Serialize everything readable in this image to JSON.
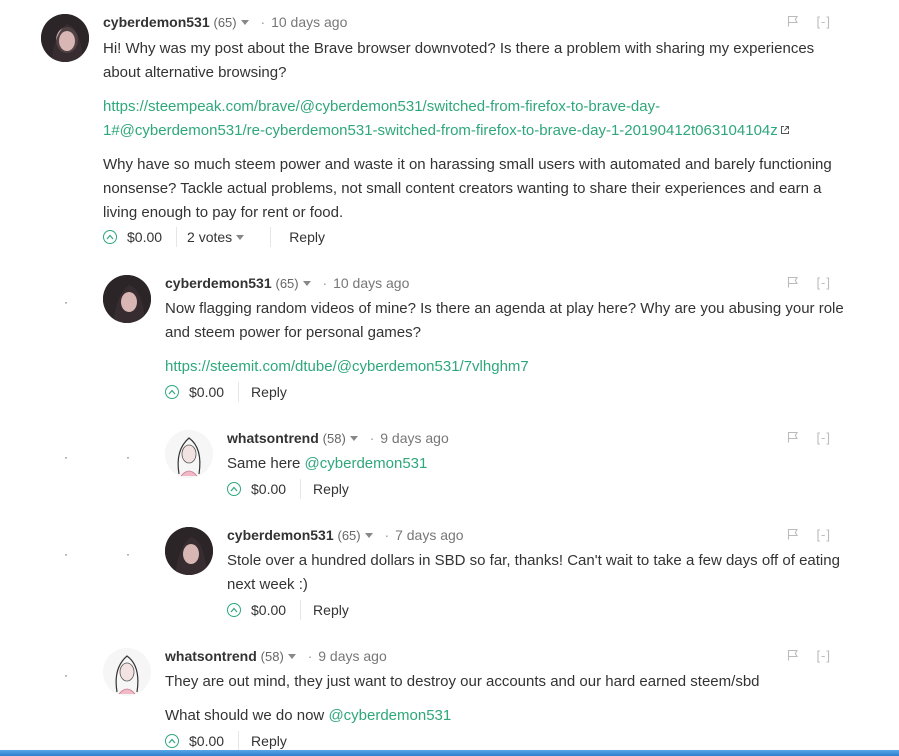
{
  "comments": [
    {
      "author": "cyberdemon531",
      "rep": "(65)",
      "age": "10 days ago",
      "paragraphs": [
        "Hi! Why was my post about the Brave browser downvoted? Is there a problem with sharing my experiences about alternative browsing?",
        "Why have so much steem power and waste it on harassing small users with automated and barely functioning nonsense? Tackle actual problems, not small content creators wanting to share their experiences and earn a living enough to pay for rent or food."
      ],
      "link_line1": "https://steempeak.com/brave/@cyberdemon531/switched-from-firefox-to-brave-day-",
      "link_line2": "1#@cyberdemon531/re-cyberdemon531-switched-from-firefox-to-brave-day-1-20190412t063104104z",
      "payout": "$0.00",
      "votes": "2 votes",
      "reply": "Reply"
    },
    {
      "author": "cyberdemon531",
      "rep": "(65)",
      "age": "10 days ago",
      "text": "Now flagging random videos of mine? Is there an agenda at play here? Why are you abusing your role and steem power for personal games?",
      "link": "https://steemit.com/dtube/@cyberdemon531/7vlhghm7",
      "payout": "$0.00",
      "reply": "Reply"
    },
    {
      "author": "whatsontrend",
      "rep": "(58)",
      "age": "9 days ago",
      "text": "Same here",
      "mention": "@cyberdemon531",
      "payout": "$0.00",
      "reply": "Reply"
    },
    {
      "author": "cyberdemon531",
      "rep": "(65)",
      "age": "7 days ago",
      "text": "Stole over a hundred dollars in SBD so far, thanks! Can't wait to take a few days off of eating next week :)",
      "payout": "$0.00",
      "reply": "Reply"
    },
    {
      "author": "whatsontrend",
      "rep": "(58)",
      "age": "9 days ago",
      "text": "They are out mind, they just want to destroy our accounts and our hard earned steem/sbd",
      "text2": "What should we do now",
      "mention": "@cyberdemon531",
      "payout": "$0.00",
      "reply": "Reply"
    }
  ],
  "collapse_label": "[-]",
  "icons": {
    "flag": "flag-icon",
    "upvote": "upvote-icon",
    "caret": "chevron-down-icon",
    "external": "external-link-icon"
  },
  "colors": {
    "link": "#2fa77c",
    "upvote": "#2fa77c",
    "bottom_bar": "#3d8fd8"
  }
}
